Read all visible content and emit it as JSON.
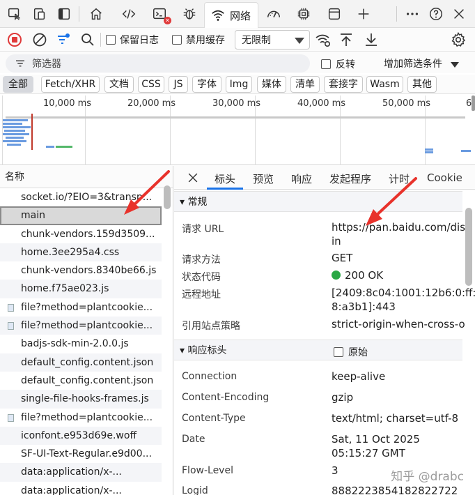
{
  "tabs": {
    "network_label": "网络"
  },
  "toolbar": {
    "preserve_log": "保留日志",
    "disable_cache": "禁用缓存",
    "throttle_value": "无限制"
  },
  "filter": {
    "placeholder": "筛选器",
    "invert": "反转",
    "add_condition": "增加筛选条件"
  },
  "chips": [
    "全部",
    "Fetch/XHR",
    "文档",
    "CSS",
    "JS",
    "字体",
    "Img",
    "媒体",
    "清单",
    "套接字",
    "Wasm",
    "其他"
  ],
  "overview": {
    "ticks": [
      "10,000 ms",
      "20,000 ms",
      "30,000 ms",
      "40,000 ms",
      "50,000 ms",
      "6"
    ]
  },
  "list": {
    "header": "名称",
    "rows": [
      "socket.io/?EIO=3&transp...",
      "main",
      "chunk-vendors.159d3509...",
      "home.3ee295a4.css",
      "chunk-vendors.8340be66.js",
      "home.f75ae023.js",
      "file?method=plantcookie...",
      "file?method=plantcookie...",
      "badjs-sdk-min-2.0.0.js",
      "default_config.content.json",
      "default_config.content.json",
      "single-file-hooks-frames.js",
      "file?method=plantcookie...",
      "iconfont.e953d69e.woff",
      "SF-UI-Text-Regular.e9d00...",
      "data:application/x-...",
      "data:application/x-..."
    ]
  },
  "detail": {
    "tabs": [
      "标头",
      "预览",
      "响应",
      "发起程序",
      "计时",
      "Cookie"
    ],
    "general": {
      "title": "常规",
      "url_key": "请求 URL",
      "url_val_1": "https://pan.baidu.com/dis",
      "url_val_2": "in",
      "method_key": "请求方法",
      "method_val": "GET",
      "status_key": "状态代码",
      "status_val": "200 OK",
      "remote_key": "远程地址",
      "remote_val_1": "[2409:8c04:1001:12b6:0:ff:",
      "remote_val_2": "8:a3b1]:443",
      "referrer_key": "引用站点策略",
      "referrer_val": "strict-origin-when-cross-o"
    },
    "response": {
      "title": "响应标头",
      "raw": "原始",
      "connection_key": "Connection",
      "connection_val": "keep-alive",
      "encoding_key": "Content-Encoding",
      "encoding_val": "gzip",
      "type_key": "Content-Type",
      "type_val": "text/html; charset=utf-8",
      "date_key": "Date",
      "date_val_1": "Sat, 11 Oct 2025",
      "date_val_2": "05:15:27 GMT",
      "flow_key": "Flow-Level",
      "flow_val": "3",
      "logid_key": "Logid",
      "logid_val": "8882223854182822722"
    }
  },
  "watermark": "知乎 @drabc",
  "colors": {
    "accent": "#1a73e8",
    "record": "#e03a3a",
    "status_ok": "#2aa845",
    "annotation": "#e8322b"
  }
}
